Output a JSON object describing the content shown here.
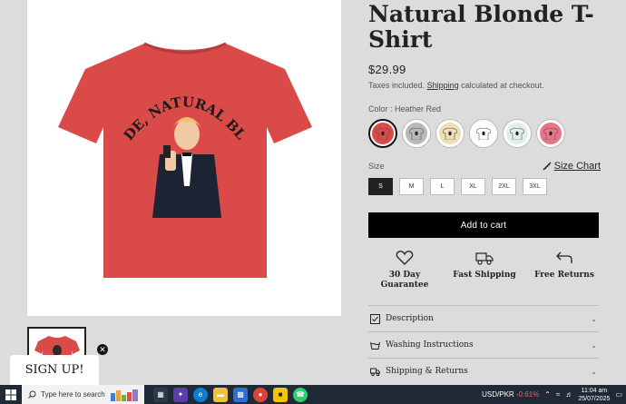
{
  "product": {
    "title": "Natural Blonde T-Shirt",
    "price": "$29.99",
    "tax_prefix": "Taxes included.",
    "tax_link": "Shipping",
    "tax_suffix": "calculated at checkout.",
    "color_label": "Color : Heather Red",
    "swatches": [
      {
        "name": "Heather Red",
        "color": "#d94a48",
        "selected": true
      },
      {
        "name": "Grey",
        "color": "#b9b9b9",
        "selected": false
      },
      {
        "name": "Cream",
        "color": "#f0dfb6",
        "selected": false
      },
      {
        "name": "White",
        "color": "#ffffff",
        "selected": false
      },
      {
        "name": "Mint",
        "color": "#dff0ea",
        "selected": false
      },
      {
        "name": "Pink",
        "color": "#e8758a",
        "selected": false
      }
    ],
    "size_label": "Size",
    "size_chart": "Size Chart",
    "sizes": [
      "S",
      "M",
      "L",
      "XL",
      "2XL",
      "3XL"
    ],
    "selected_size": "S",
    "add_to_cart": "Add to cart",
    "shirt_text": "BLONDE, NATURAL BLONDE",
    "features": [
      {
        "label_line1": "30 Day",
        "label_line2": "Guarantee",
        "icon": "heart-icon"
      },
      {
        "label_line1": "Fast Shipping",
        "label_line2": "",
        "icon": "truck-icon"
      },
      {
        "label_line1": "Free Returns",
        "label_line2": "",
        "icon": "return-arrow-icon"
      }
    ],
    "accordions": [
      {
        "label": "Description",
        "icon": "checkbox-icon"
      },
      {
        "label": "Washing Instructions",
        "icon": "washing-icon"
      },
      {
        "label": "Shipping & Returns",
        "icon": "truck-icon"
      }
    ]
  },
  "signup": {
    "label": "SIGN UP!"
  },
  "taskbar": {
    "search_placeholder": "Type here to search",
    "currency": "USD/PKR",
    "currency_change": "-0.61%",
    "time": "11:04 am",
    "date": "25/07/2025"
  },
  "colors": {
    "shirt": "#d94a48",
    "accent_black": "#000000",
    "taskbar": "#1f2a36"
  }
}
